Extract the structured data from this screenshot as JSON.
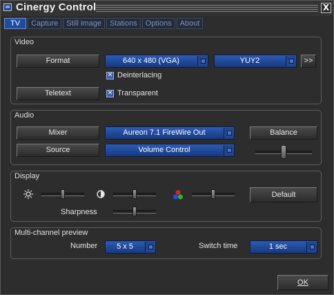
{
  "window": {
    "title": "Cinergy Control",
    "close_glyph": "X"
  },
  "tabs": [
    {
      "label": "TV",
      "active": true
    },
    {
      "label": "Capture",
      "active": false
    },
    {
      "label": "Still image",
      "active": false
    },
    {
      "label": "Stations",
      "active": false
    },
    {
      "label": "Options",
      "active": false
    },
    {
      "label": "About",
      "active": false
    }
  ],
  "video": {
    "title": "Video",
    "format_button": "Format",
    "format_value": "640 x 480 (VGA)",
    "colorspace_value": "YUY2",
    "more_button": ">>",
    "deinterlacing_label": "Deinterlacing",
    "deinterlacing_checked": true,
    "teletext_button": "Teletext",
    "transparent_label": "Transparent",
    "transparent_checked": true,
    "check_glyph": "✕"
  },
  "audio": {
    "title": "Audio",
    "mixer_button": "Mixer",
    "mixer_value": "Aureon 7.1 FireWire Out",
    "source_button": "Source",
    "source_value": "Volume Control",
    "balance_button": "Balance",
    "balance_level": 0.5
  },
  "display": {
    "title": "Display",
    "brightness_level": 0.5,
    "contrast_level": 0.5,
    "color_level": 0.5,
    "sharpness_label": "Sharpness",
    "sharpness_level": 0.5,
    "default_button": "Default",
    "icons": [
      "sun-icon",
      "contrast-icon",
      "rgb-color-icon"
    ],
    "icon_colors": {
      "red": "#e02020",
      "green": "#20c020",
      "blue": "#2050f0"
    }
  },
  "multichannel": {
    "title": "Multi-channel preview",
    "number_label": "Number",
    "number_value": "5 x 5",
    "switch_label": "Switch time",
    "switch_value": "1 sec"
  },
  "footer": {
    "ok_button": "OK"
  },
  "colors": {
    "accent": "#1c4da0",
    "background": "#2d2d2d"
  }
}
